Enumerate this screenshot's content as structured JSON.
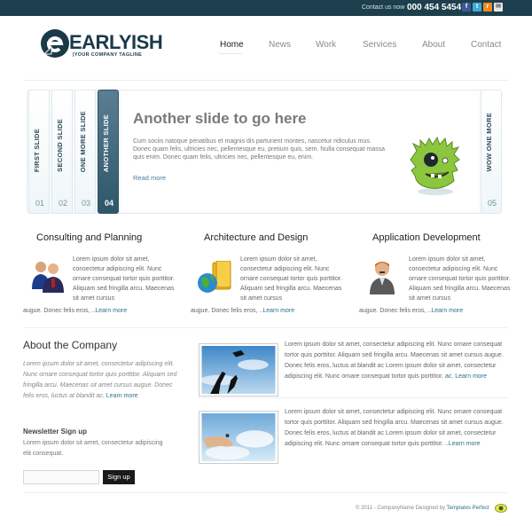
{
  "topbar": {
    "contact_label": "Contact us now",
    "phone": "000 454 5454",
    "social_icons": [
      "facebook-icon",
      "twitter-icon",
      "rss-icon",
      "email-icon"
    ]
  },
  "logo": {
    "name": "EARLYISH",
    "tagline": "|YOUR COMPANY TAGLINE"
  },
  "nav": [
    {
      "label": "Home",
      "active": true
    },
    {
      "label": "News"
    },
    {
      "label": "Work"
    },
    {
      "label": "Services"
    },
    {
      "label": "About"
    },
    {
      "label": "Contact"
    }
  ],
  "slider": {
    "tabs": [
      {
        "label": "FIRST SLIDE",
        "num": "01"
      },
      {
        "label": "SECOND SLIDE",
        "num": "02"
      },
      {
        "label": "ONE MORE SLIDE",
        "num": "03"
      },
      {
        "label": "ANOTHER SLIDE",
        "num": "04",
        "active": true
      },
      {
        "label": "WOW ONE MORE",
        "num": "05"
      }
    ],
    "title": "Another slide to go here",
    "text": "Cum sociis natoque penatibus et magnis dis parturient montes, nascetur ridiculus mus. Donec quam felis, ultricies nec, pellentesque eu, pretium quis, sem. Nulla consequat massa quis enim. Donec quam felis, ultricies nec, pellentesque eu, enim.",
    "more": "Read more"
  },
  "services": [
    {
      "title": "Consulting and Planning",
      "text": "Lorem ipsum dolor sit amet, consectetur adipiscing elit. Nunc ornare consequat tortor quis porttitor. Aliquam sed fringilla arcu. Maecenas sit amet cursus",
      "tail": "augue. Donec felis eros, ..",
      "learn": "Learn more"
    },
    {
      "title": "Architecture and Design",
      "text": "Lorem ipsum dolor sit amet, consectetur adipiscing elit. Nunc ornare consequat tortor quis porttitor. Aliquam sed fringilla arcu. Maecenas sit amet cursus",
      "tail": "augue. Donec felis eros, ..",
      "learn": "Learn more"
    },
    {
      "title": "Application Development",
      "text": "Lorem ipsum dolor sit amet, consectetur adipiscing elit. Nunc ornare consequat tortor quis porttitor. Aliquam sed fringilla arcu. Maecenas sit amet cursus",
      "tail": "augue. Donec felis eros, ..",
      "learn": "Learn more"
    }
  ],
  "about": {
    "title": "About the Company",
    "text": "Lorem ipsum dolor sit amet, consectetur adipiscing elit. Nunc ornare consequat tortor quis porttitor. Aliquam sed fringilla arcu. Maecenas sit amet cursus augue. Donec felis eros, luctus at blandit ac.",
    "learn": "Learn more"
  },
  "newsletter": {
    "title": "Newsletter Sign up",
    "text": "Lorem ipsum dolor sit amet, consectetur adipiscing elit consequat.",
    "input_placeholder": "",
    "button": "Sign up"
  },
  "articles": [
    {
      "text": "Lorem ipsum dolor sit amet, consectetur adipiscing elit. Nunc ornare consequat tortor quis porttitor. Aliquam sed fringilla arcu. Maecenas sit amet cursus augue. Donec felis eros, luctus at blandit ac Lorem ipsum dolor sit amet, consectetur adipiscing elit. Nunc ornare consequat tortor quis porttitor.",
      "learn": "ac. Learn more"
    },
    {
      "text": "Lorem ipsum dolor sit amet, consectetur adipiscing elit. Nunc ornare consequat tortor quis porttitor. Aliquam sed fringilla arcu. Maecenas sit amet cursus augue. Donec felis eros, luctus at blandit ac Lorem ipsum dolor sit amet, consectetur adipiscing elit. Nunc ornare consequat tortor quis porttitor.",
      "learn": "..Learn more"
    }
  ],
  "footer": {
    "copyright": "© 2011 - CompanyName   Designed by",
    "designer": "Templates Perfect"
  },
  "colors": {
    "topbar": "#1d3f4d",
    "accent": "#2f5569",
    "link": "#2f6f8f"
  }
}
